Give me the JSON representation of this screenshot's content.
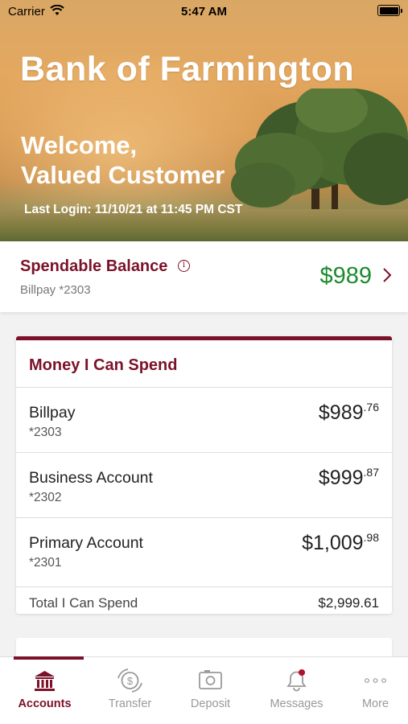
{
  "status_bar": {
    "carrier": "Carrier",
    "time": "5:47 AM"
  },
  "hero": {
    "brand": "Bank of Farmington",
    "welcome_line1": "Welcome,",
    "welcome_line2": "Valued Customer",
    "last_login": "Last Login: 11/10/21 at 11:45 PM CST"
  },
  "spendable": {
    "title": "Spendable Balance",
    "account": "Billpay *2303",
    "amount": "$989",
    "info_icon": "info-icon",
    "chevron_icon": "chevron-right-icon"
  },
  "money_card": {
    "title": "Money I Can Spend",
    "accounts": [
      {
        "name": "Billpay",
        "number": "*2303",
        "amount_main": "$989",
        "amount_cents": ".76"
      },
      {
        "name": "Business Account",
        "number": "*2302",
        "amount_main": "$999",
        "amount_cents": ".87"
      },
      {
        "name": "Primary Account",
        "number": "*2301",
        "amount_main": "$1,009",
        "amount_cents": ".98"
      }
    ],
    "total_label": "Total I Can Spend",
    "total_value": "$2,999.61"
  },
  "tabs": [
    {
      "label": "Accounts",
      "icon": "bank-icon",
      "active": true
    },
    {
      "label": "Transfer",
      "icon": "transfer-icon",
      "active": false
    },
    {
      "label": "Deposit",
      "icon": "camera-icon",
      "active": false
    },
    {
      "label": "Messages",
      "icon": "bell-icon",
      "active": false
    },
    {
      "label": "More",
      "icon": "more-dots-icon",
      "active": false
    }
  ],
  "colors": {
    "brand_maroon": "#7b1229",
    "balance_green": "#1d8a2d",
    "inactive_gray": "#9a9a9a"
  }
}
